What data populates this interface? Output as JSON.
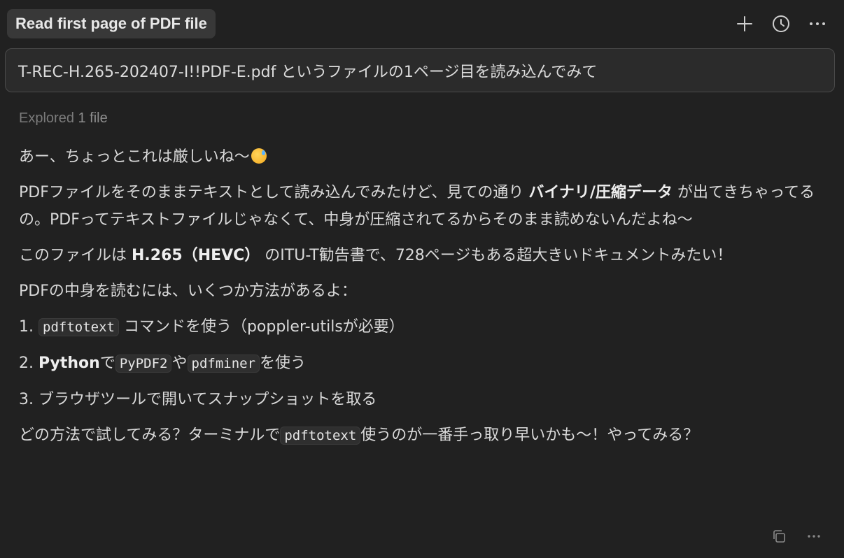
{
  "header": {
    "title": "Read first page of PDF file",
    "actions": [
      {
        "name": "new-chat",
        "icon": "plus-icon"
      },
      {
        "name": "history",
        "icon": "clock-icon"
      },
      {
        "name": "more",
        "icon": "ellipsis-icon"
      }
    ]
  },
  "user_message": "T-REC-H.265-202407-I!!PDF-E.pdf というファイルの1ページ目を読み込んでみて",
  "explored": {
    "label": "Explored",
    "count": "1 file"
  },
  "response": {
    "p1": "あー、ちょっとこれは厳しいね〜",
    "p1_emoji": "grinning-face-with-sweat",
    "p2_a": "PDFファイルをそのままテキストとして読み込んでみたけど、見ての通り ",
    "p2_bold": "バイナリ/圧縮データ",
    "p2_b": " が出てきちゃってるの。PDFってテキストファイルじゃなくて、中身が圧縮されてるからそのまま読めないんだよね〜",
    "p3_a": "このファイルは ",
    "p3_bold": "H.265（HEVC）",
    "p3_b": " のITU-T勧告書で、728ページもある超大きいドキュメントみたい！",
    "p4": "PDFの中身を読むには、いくつか方法があるよ：",
    "list": {
      "item1_num": "1.",
      "item1_code": "pdftotext",
      "item1_text": " コマンドを使う（poppler-utilsが必要）",
      "item2_num": "2.",
      "item2_bold": "Python",
      "item2_a": "で",
      "item2_code1": "PyPDF2",
      "item2_b": "や",
      "item2_code2": "pdfminer",
      "item2_c": "を使う",
      "item3_num": "3.",
      "item3_text": "ブラウザツールで開いてスナップショットを取る"
    },
    "p5_a": "どの方法で試してみる？ターミナルで",
    "p5_code": "pdftotext",
    "p5_b": "使うのが一番手っ取り早いかも〜！やってみる？"
  },
  "footer": {
    "actions": [
      {
        "name": "copy",
        "icon": "copy-icon"
      },
      {
        "name": "more",
        "icon": "ellipsis-icon"
      }
    ]
  }
}
